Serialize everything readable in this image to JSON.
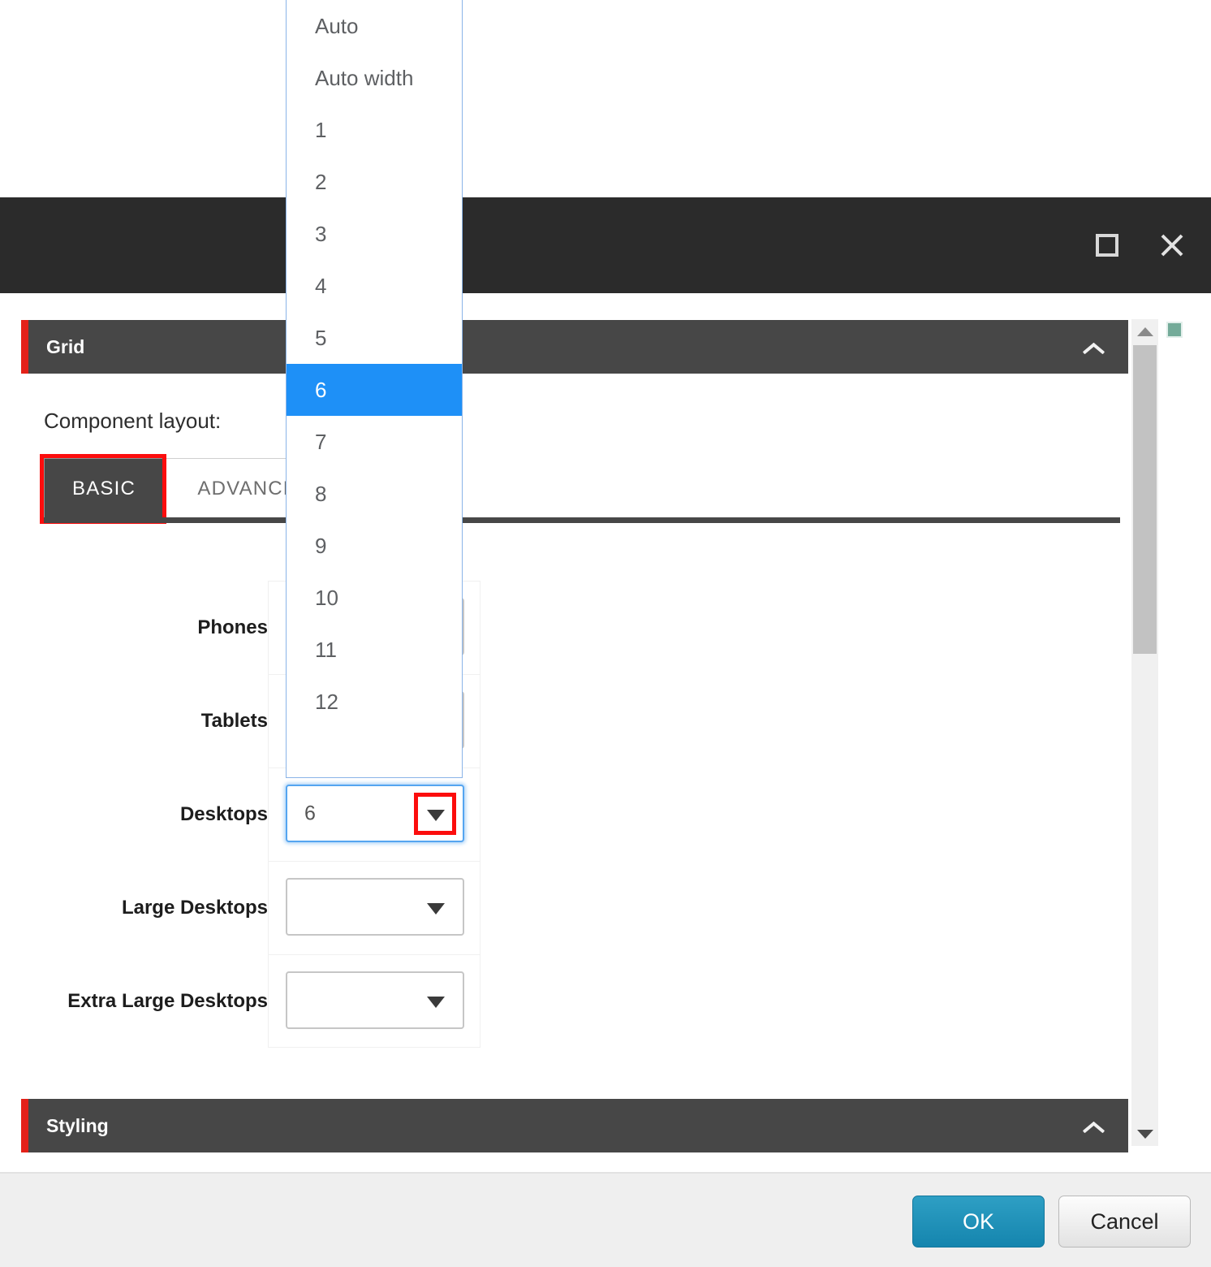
{
  "window": {
    "title": "",
    "maximize_label": "Maximize",
    "close_label": "Close"
  },
  "sections": {
    "grid": {
      "title": "Grid",
      "collapse_icon": "chevron-up-icon"
    },
    "styling": {
      "title": "Styling",
      "collapse_icon": "chevron-up-icon"
    }
  },
  "form": {
    "component_layout_label": "Component layout:",
    "tabs": [
      {
        "label": "BASIC",
        "active": true,
        "highlighted": true
      },
      {
        "label": "ADVANCED",
        "active": false,
        "highlighted": false
      }
    ],
    "rows": [
      {
        "label": "Phones",
        "value": "",
        "focused": false,
        "caret_highlighted": false
      },
      {
        "label": "Tablets",
        "value": "",
        "focused": false,
        "caret_highlighted": false
      },
      {
        "label": "Desktops",
        "value": "6",
        "focused": true,
        "caret_highlighted": true
      },
      {
        "label": "Large Desktops",
        "value": "",
        "focused": false,
        "caret_highlighted": false
      },
      {
        "label": "Extra Large Desktops",
        "value": "",
        "focused": false,
        "caret_highlighted": false
      }
    ]
  },
  "dropdown": {
    "open": true,
    "selected_value": "6",
    "options": [
      "Auto",
      "Auto width",
      "1",
      "2",
      "3",
      "4",
      "5",
      "6",
      "7",
      "8",
      "9",
      "10",
      "11",
      "12"
    ]
  },
  "scrollbar": {
    "up_arrow": "triangle-up-icon",
    "down_arrow": "triangle-down-icon",
    "indicator_color": "#74ab99"
  },
  "footer": {
    "ok_label": "OK",
    "cancel_label": "Cancel"
  },
  "colors": {
    "titlebar": "#2b2b2b",
    "section_header": "#474747",
    "section_accent": "#e32119",
    "highlight_red": "#fc0d0d",
    "dropdown_selected": "#1e90f7",
    "focus_blue": "#55a5f0",
    "ok_button": "#1585ae"
  }
}
